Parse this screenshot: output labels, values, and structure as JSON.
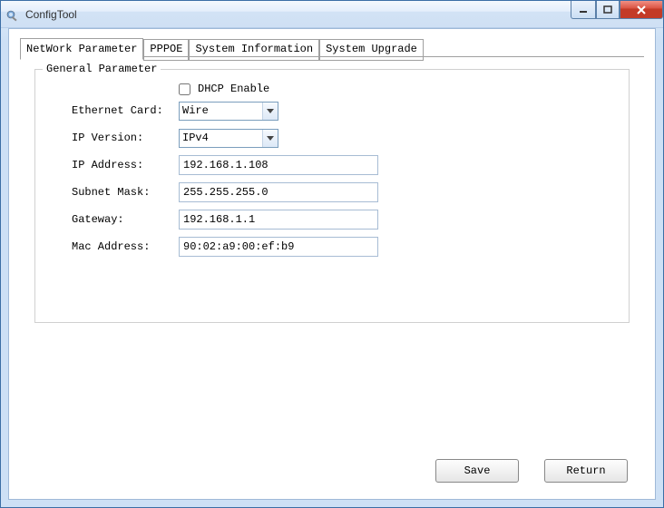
{
  "window": {
    "title": "ConfigTool"
  },
  "tabs": [
    {
      "label": "NetWork Parameter",
      "active": true
    },
    {
      "label": "PPPOE",
      "active": false
    },
    {
      "label": "System Information",
      "active": false
    },
    {
      "label": "System Upgrade",
      "active": false
    }
  ],
  "fieldset": {
    "legend": "General Parameter",
    "dhcp": {
      "label": "DHCP Enable",
      "checked": false
    },
    "ethernet_card": {
      "label": "Ethernet Card:",
      "value": "Wire"
    },
    "ip_version": {
      "label": "IP Version:",
      "value": "IPv4"
    },
    "ip_address": {
      "label": "IP Address:",
      "value": "192.168.1.108"
    },
    "subnet_mask": {
      "label": "Subnet Mask:",
      "value": "255.255.255.0"
    },
    "gateway": {
      "label": "Gateway:",
      "value": "192.168.1.1"
    },
    "mac_address": {
      "label": "Mac Address:",
      "value": "90:02:a9:00:ef:b9"
    }
  },
  "buttons": {
    "save": "Save",
    "return": "Return"
  }
}
